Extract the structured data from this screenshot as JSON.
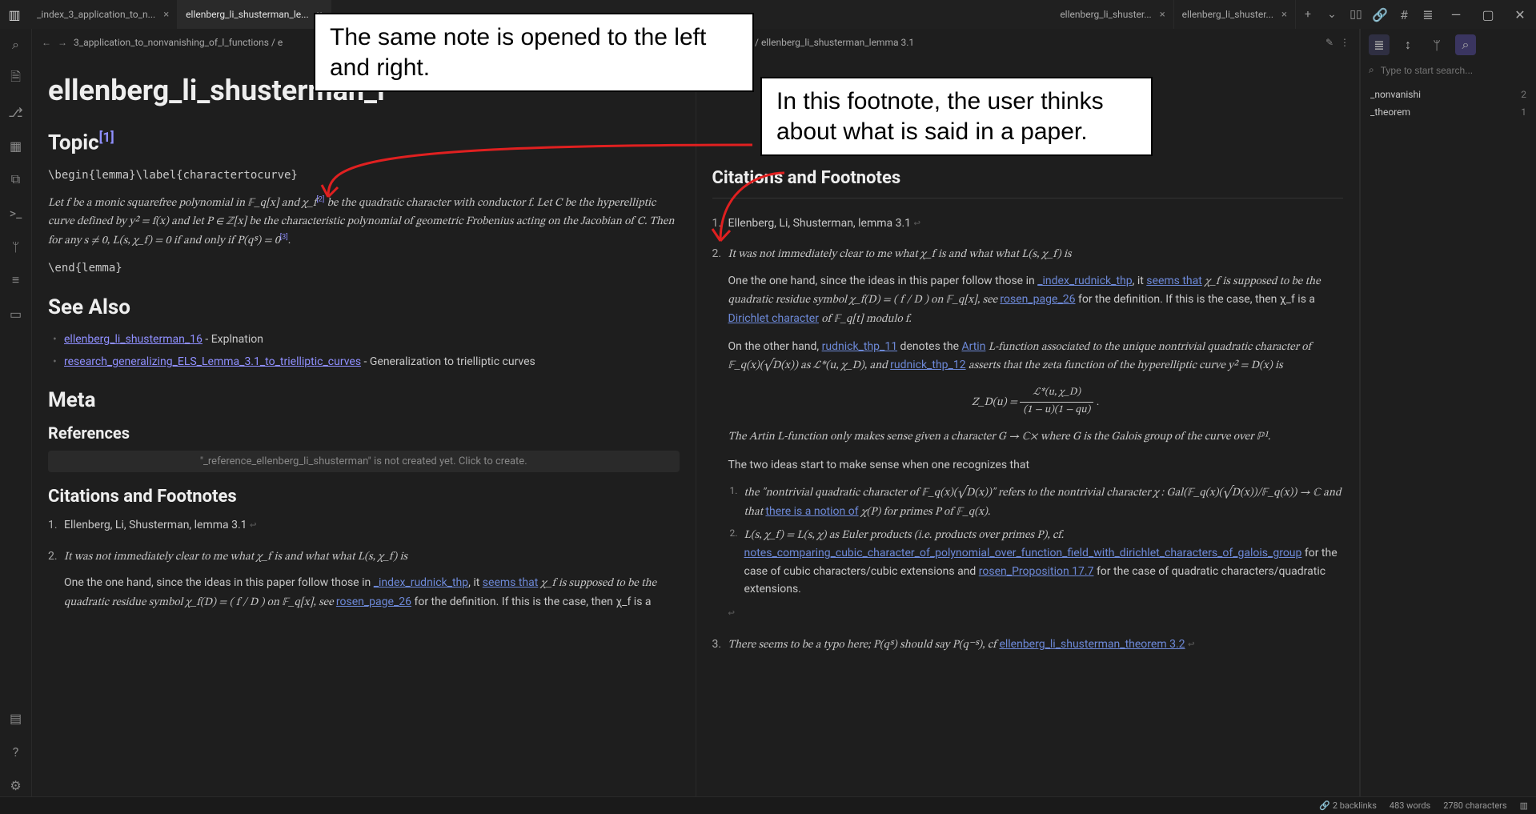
{
  "titlebar": {
    "tabs": [
      {
        "label": "_index_3_application_to_n...",
        "active": false
      },
      {
        "label": "ellenberg_li_shusterman_le...",
        "active": true
      },
      {
        "label": "ellenberg_li_shuster...",
        "active": false
      },
      {
        "label": "ellenberg_li_shuster...",
        "active": false
      }
    ],
    "plus": "+",
    "caret": "⌄",
    "split": "▯▯",
    "rtools": {
      "link": "🔗",
      "hash": "#",
      "list": "≣"
    },
    "window": {
      "min": "—",
      "max": "▢",
      "close": "✕"
    }
  },
  "activitybar": {
    "search": "⌕",
    "file": "🗎",
    "git": "⎇",
    "apps": "▦",
    "copy": "⧉",
    "terminal": ">_",
    "branch": "ᛘ",
    "layers": "≡",
    "panel": "▭",
    "book": "▤",
    "help": "?",
    "gear": "⚙"
  },
  "breadcrumbs": {
    "left": {
      "back": "←",
      "forward": "→",
      "path": "3_application_to_nonvanishing_of_l_functions / e"
    },
    "right": {
      "path": "l_functions / ellenberg_li_shusterman_lemma 3.1",
      "edit": "✎",
      "more": "⋮"
    }
  },
  "note": {
    "title": "ellenberg_li_shusterman_l",
    "topic_heading": "Topic",
    "topic_ref": "[1]",
    "lemma_begin": "\\begin{lemma}\\label{charactertocurve}",
    "lemma_para_a": "Let f be a monic squarefree polynomial in 𝔽_q[x] and χ_f",
    "lemma_ref2": "[2]",
    "lemma_para_b": " be the quadratic character with conductor f. Let C be the hyperelliptic curve defined by y² = f(x) and let P ∈ ℤ[x] be the characteristic polynomial of geometric Frobenius acting on the Jacobian of C. Then for any s ≠ 0, L(s, χ_f) = 0 if and only if P(qˢ) = 0",
    "lemma_ref3": "[3]",
    "lemma_end": "\\end{lemma}",
    "see_also": "See Also",
    "see_also_items": [
      {
        "link": "ellenberg_li_shusterman_16",
        "tail": " - Explnation"
      },
      {
        "link": "research_generalizing_ELS_Lemma_3.1_to_trielliptic_curves",
        "tail": " - Generalization to trielliptic curves"
      }
    ],
    "meta": "Meta",
    "references": "References",
    "ref_placeholder": "\"_reference_ellenberg_li_shusterman\" is not created yet. Click to create.",
    "citations": "Citations and Footnotes",
    "fn1": "Ellenberg, Li, Shusterman, lemma 3.1",
    "fn2_lead": "It was not immediately clear to me what χ_f is and what what L(s, χ_f) is",
    "fn2_p1a": "One the one hand, since the ideas in this paper follow those in ",
    "fn2_link_idx": "_index_rudnick_thp",
    "fn2_p1b": ", it ",
    "fn2_link_seems": "seems that",
    "fn2_p1c": " χ_f is supposed to be the quadratic residue symbol χ_f(D) = ( f / D ) on 𝔽_q[x], see ",
    "fn2_link_rosen": "rosen_page_26",
    "fn2_p1d": " for the definition. If this is the case, then χ_f is a ",
    "fn2_link_dirichlet": "Dirichlet character",
    "fn2_p1e": " of 𝔽_q[t] modulo f.",
    "fn2_p2a": "On the other hand, ",
    "fn2_link_r11": "rudnick_thp_11",
    "fn2_p2b": " denotes the ",
    "fn2_link_artin": "Artin",
    "fn2_p2c": " L-function associated to the unique nontrivial quadratic character of 𝔽_q(x)(√D(x)) as ℒ*(u, χ_D), and ",
    "fn2_link_r12": "rudnick_thp_12",
    "fn2_p2d": " asserts that the zeta function of the hyperelliptic curve y² = D(x) is",
    "fn2_eq_lhs": "Z_D(u) = ",
    "fn2_eq_num": "ℒ*(u, χ_D)",
    "fn2_eq_den": "(1 − u)(1 − qu)",
    "fn2_p3": "The Artin L-function only makes sense given a character G → ℂ× where G is the Galois group of the curve over ℙ¹.",
    "fn2_p4": "The two ideas start to make sense when one recognizes that",
    "fn2_inner1a": "the \"nontrivial quadratic character of 𝔽_q(x)(√D(x))\" refers to the nontrivial character χ : Gal(𝔽_q(x)(√D(x))/𝔽_q(x)) → ℂ and that ",
    "fn2_inner1_link": "there is a notion of",
    "fn2_inner1b": " χ(P) for primes P of 𝔽_q(x).",
    "fn2_inner2a": "L(s, χ_f) = L(s, χ) as Euler products (i.e. products over primes P), cf. ",
    "fn2_inner2_link1": "notes_comparing_cubic_character_of_polynomial_over_function_field_with_dirichlet_characters_of_galois_group",
    "fn2_inner2b": " for the case of cubic characters/cubic extensions and ",
    "fn2_inner2_link2": "rosen_Proposition 17.7",
    "fn2_inner2c": " for the case of quadratic characters/quadratic extensions.",
    "fn3a": "There seems to be a typo here; P(qˢ) should say P(q⁻ˢ), cf ",
    "fn3_link": "ellenberg_li_shusterman_theorem 3.2"
  },
  "rightbar": {
    "search_placeholder": "Type to start search...",
    "items": [
      {
        "label": "_nonvanishi",
        "count": "2"
      },
      {
        "label": "_theorem",
        "count": "1"
      }
    ]
  },
  "statusbar": {
    "backlinks_label": "2 backlinks",
    "words": "483 words",
    "chars": "2780 characters"
  },
  "callouts": {
    "top": "The same note is opened to the left and right.",
    "right": "In this footnote, the user thinks about what is said in a paper."
  }
}
